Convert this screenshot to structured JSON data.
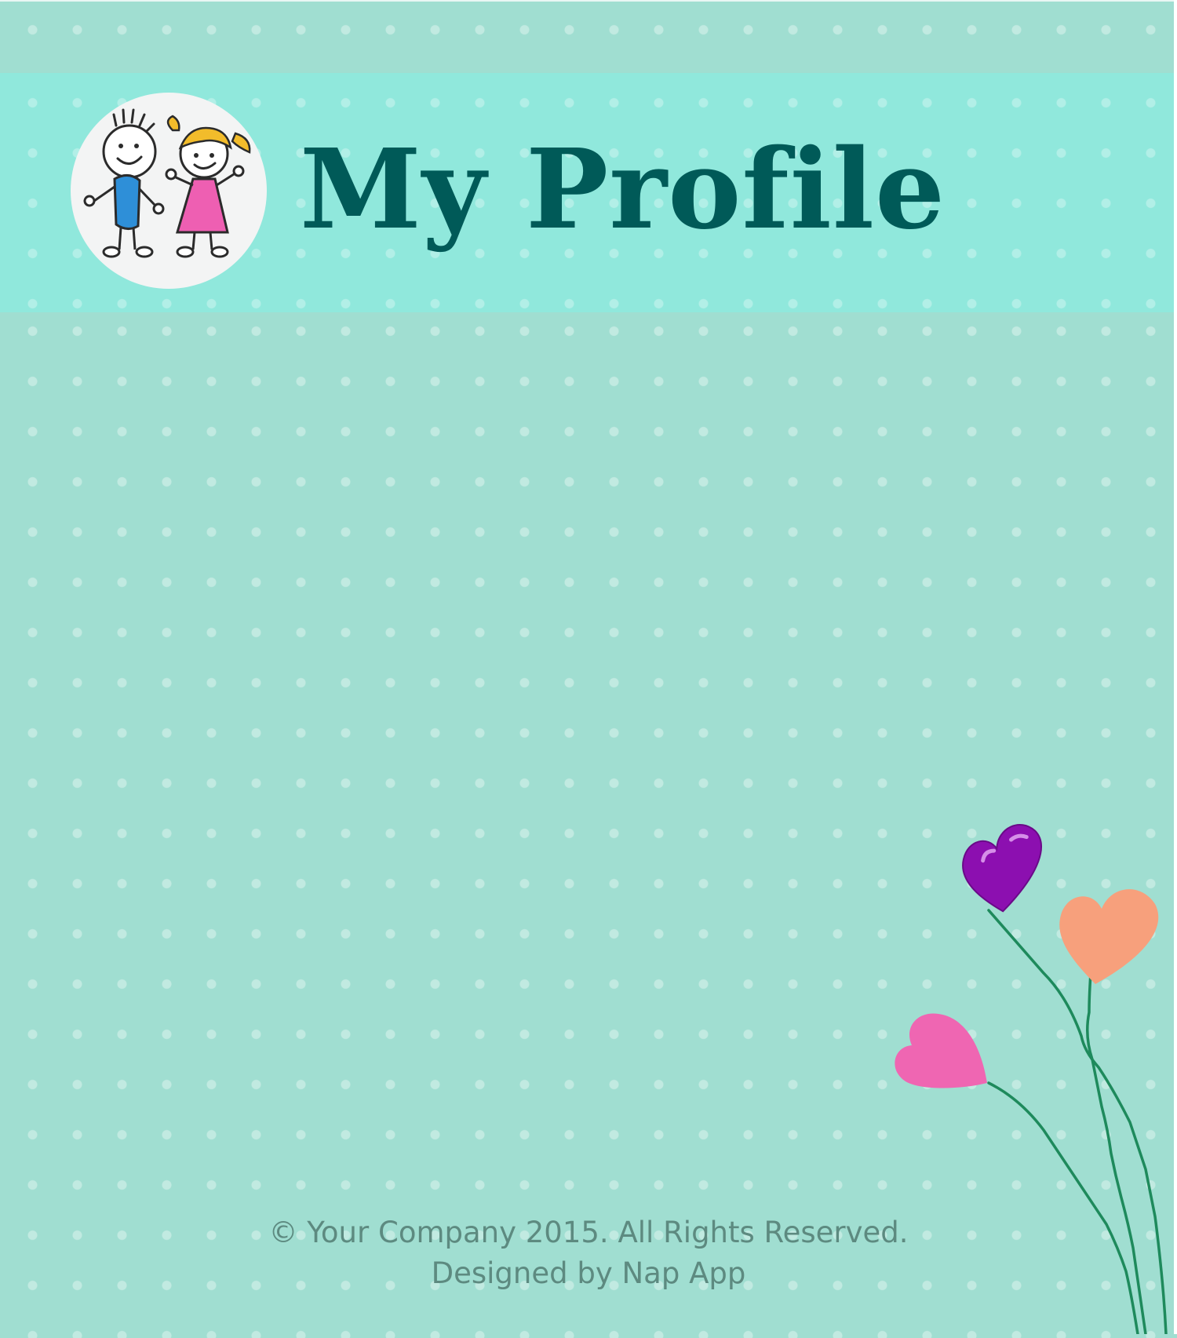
{
  "header": {
    "title": "My Profile",
    "avatar_icon": "kids-drawing-icon"
  },
  "footer": {
    "copyright": "© Your Company 2015. All Rights Reserved.",
    "credit": "Designed by Nap App"
  },
  "decoration": {
    "icon": "heart-balloons-icon"
  },
  "colors": {
    "background": "#a0ded1",
    "header_band": "#90e8dc",
    "title": "#005a58",
    "footer_text": "#5d8a80",
    "balloon_purple": "#8c0fb0",
    "balloon_orange": "#f7a07c",
    "balloon_pink": "#ef66b2",
    "string_green": "#1e8a5c"
  }
}
